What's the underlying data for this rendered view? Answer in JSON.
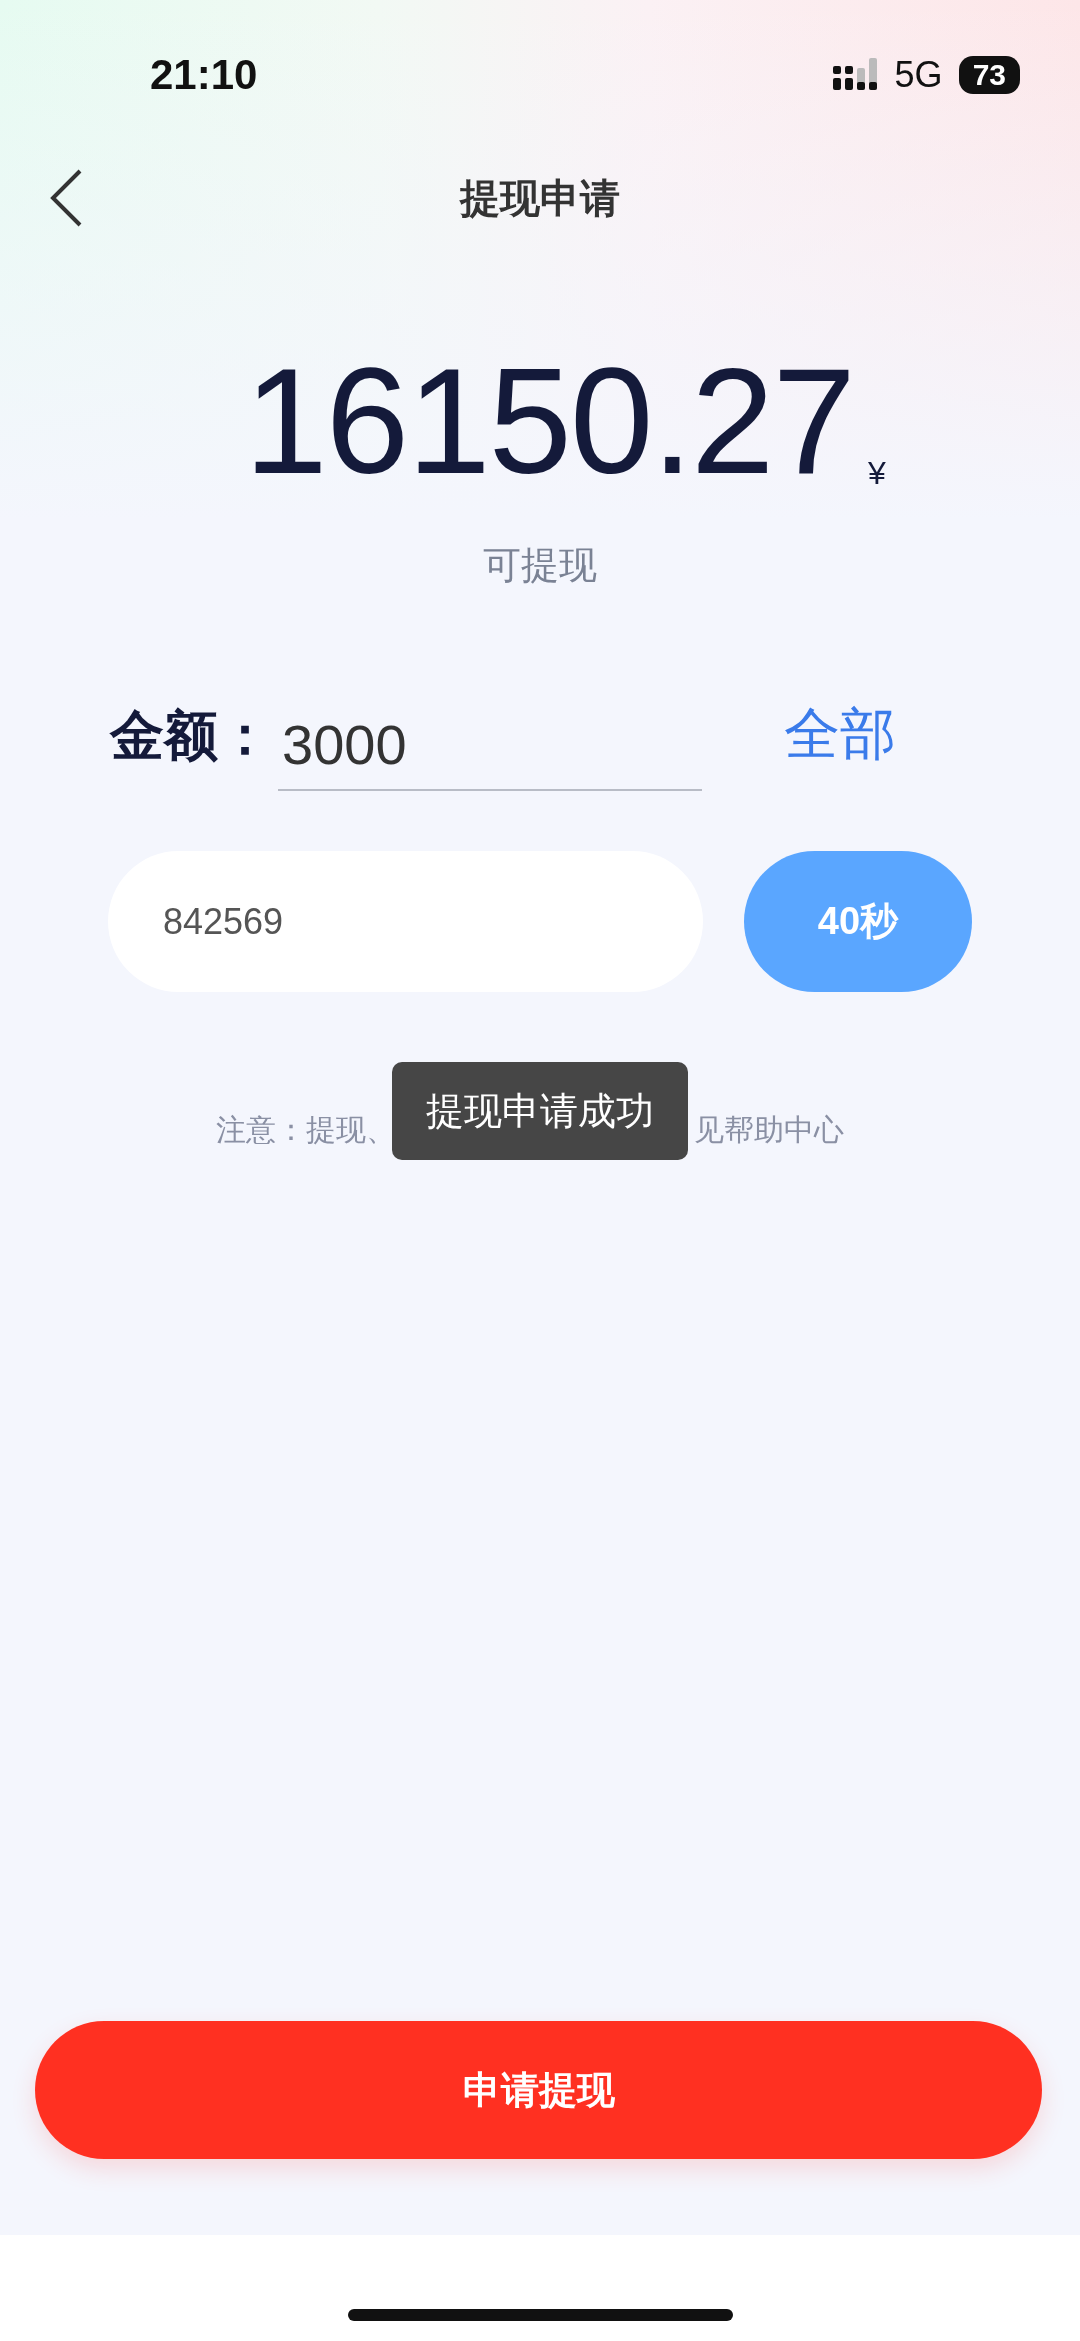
{
  "status_bar": {
    "time": "21:10",
    "network": "5G",
    "battery": "73"
  },
  "header": {
    "title": "提现申请"
  },
  "balance": {
    "amount": "16150.27",
    "currency": "¥",
    "label": "可提现"
  },
  "amount_field": {
    "label": "金额：",
    "value": "3000",
    "all_button": "全部"
  },
  "code_field": {
    "value": "842569",
    "countdown_button": "40秒"
  },
  "notice": {
    "start": "注意：提现、",
    "end": "见帮助中心"
  },
  "toast": "提现申请成功",
  "submit_button": "申请提现"
}
